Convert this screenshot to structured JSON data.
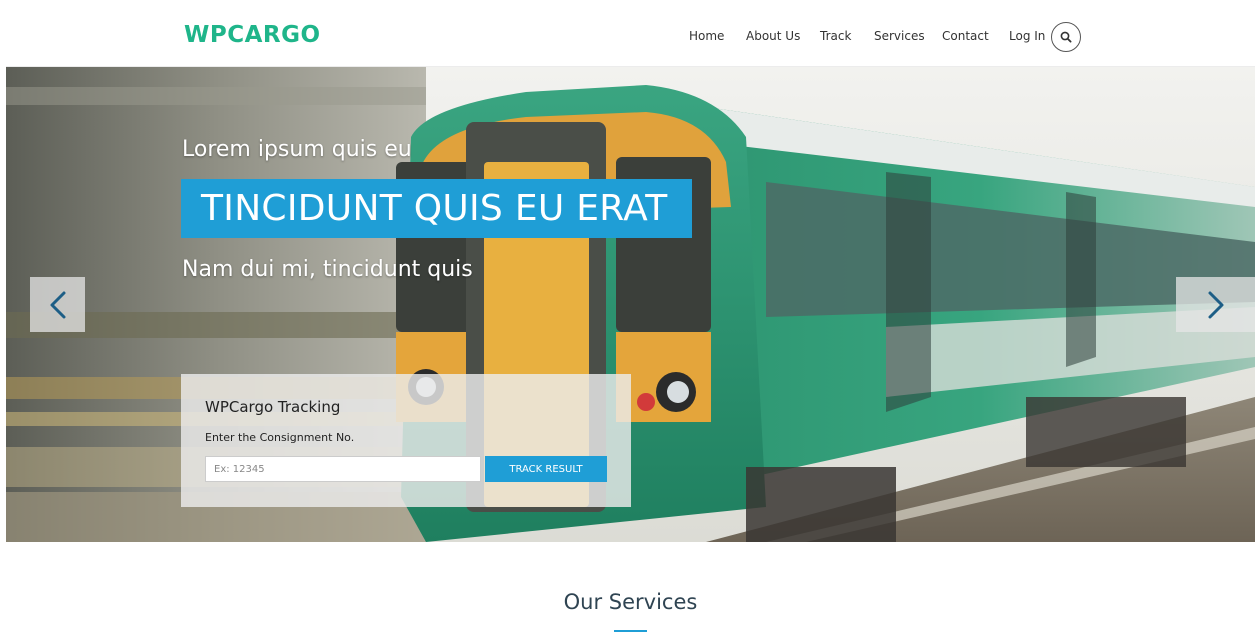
{
  "header": {
    "logo": "WPCARGO",
    "nav": [
      "Home",
      "About Us",
      "Track",
      "Services",
      "Contact",
      "Log In"
    ]
  },
  "hero": {
    "kicker": "Lorem ipsum quis eu",
    "headline": "TINCIDUNT QUIS EU ERAT",
    "subline": "Nam dui mi, tincidunt quis",
    "tracking": {
      "title": "WPCargo Tracking",
      "label": "Enter the Consignment No.",
      "placeholder": "Ex: 12345",
      "button": "TRACK RESULT"
    }
  },
  "services": {
    "title": "Our Services"
  },
  "colors": {
    "brand": "#1fb58a",
    "accent": "#1f9ed6"
  },
  "icons": {
    "search": "search-icon",
    "prev": "chevron-left-icon",
    "next": "chevron-right-icon"
  }
}
